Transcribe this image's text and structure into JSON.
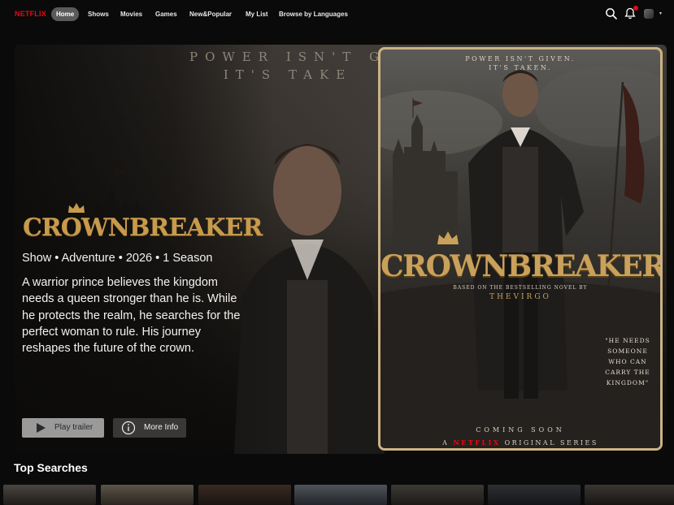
{
  "nav": {
    "logo": "NETFLIX",
    "items": [
      {
        "label": "Home",
        "active": true
      },
      {
        "label": "Shows",
        "active": false
      },
      {
        "label": "Movies",
        "active": false
      },
      {
        "label": "Games",
        "active": false
      },
      {
        "label": "New&Popular",
        "active": false
      },
      {
        "label": "My List",
        "active": false
      },
      {
        "label": "Browse by Languages",
        "active": false
      }
    ],
    "icons": [
      "search-icon",
      "bell-icon",
      "avatar",
      "caret-down-icon"
    ]
  },
  "hero": {
    "background_tagline": "POWER ISN'T G\nIT'S TAKE",
    "title": "CROWNBREAKER",
    "meta": "Show • Adventure • 2026 • 1 Season",
    "description": "A warrior prince believes the kingdom needs a queen stronger than he is. While he protects the realm, he searches for the perfect woman to rule. His journey reshapes the future of the crown.",
    "play_label": "Play trailer",
    "info_label": "More Info"
  },
  "poster": {
    "tagline": "POWER ISN'T GIVEN.\nIT'S TAKEN.",
    "title": "CROWNBREAKER",
    "based_on": "BASED ON THE BESTSELLING NOVEL BY",
    "author": "THEVIRGO",
    "quote": "\"HE NEEDS\nSOMEONE\nWHO CAN\nCARRY THE\nKINGDOM\"",
    "coming_soon": "COMING SOON",
    "series_prefix": "A",
    "series_brand": "NETFLIX",
    "series_suffix": "ORIGINAL SERIES"
  },
  "row": {
    "title": "Top Searches",
    "thumb_count": 7
  },
  "colors": {
    "brand_red": "#e50914",
    "gold": "#c79a4c",
    "poster_border": "#cbb386"
  }
}
